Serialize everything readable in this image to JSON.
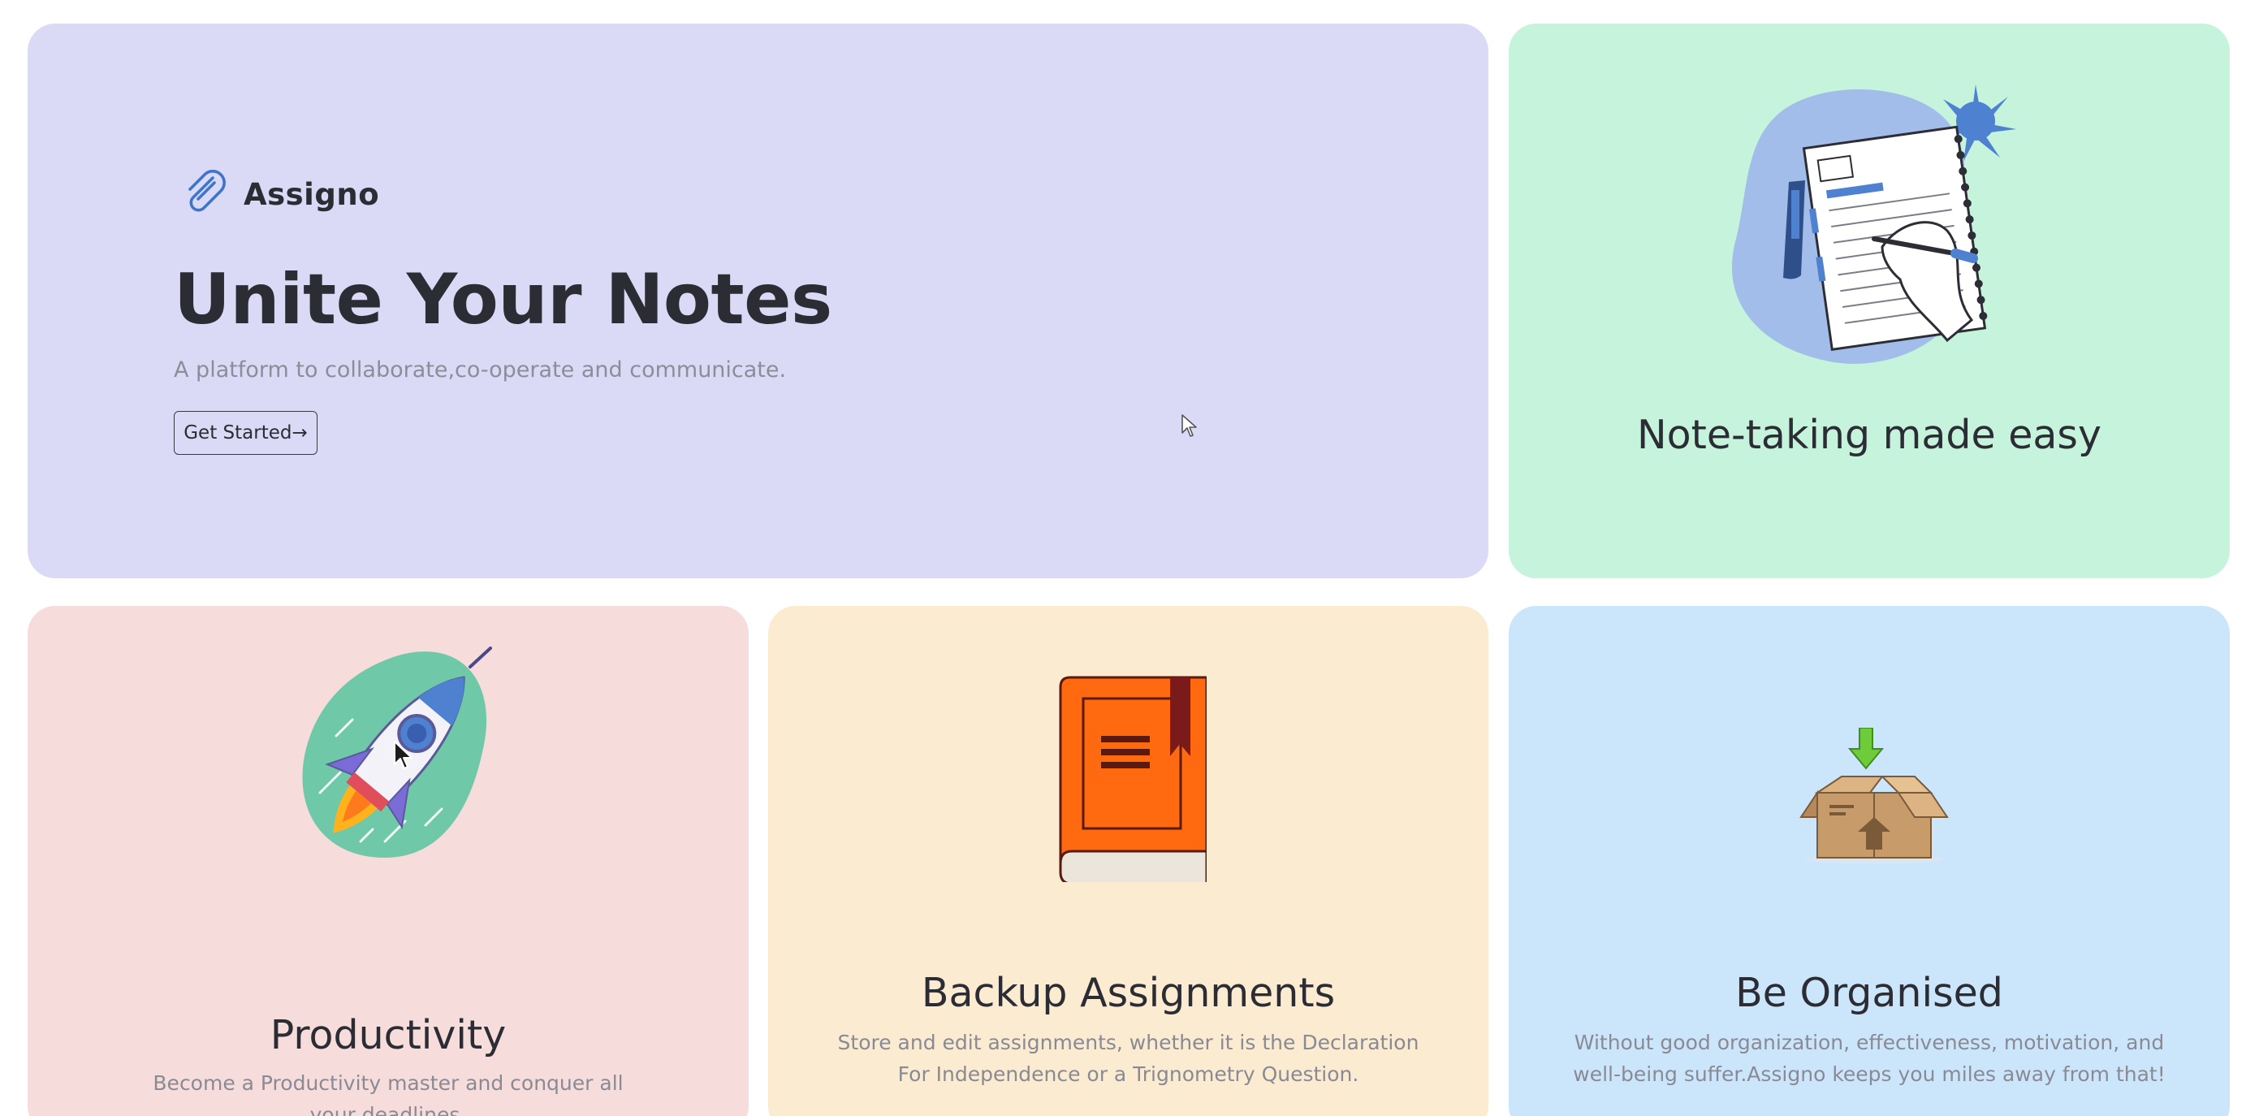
{
  "hero": {
    "brand": "Assigno",
    "title": "Unite Your Notes",
    "subtitle": "A platform to collaborate,co-operate and communicate.",
    "cta_label": "Get Started→"
  },
  "cards": {
    "notes": {
      "title": "Note-taking made easy",
      "icon": "notebook-writing-illustration"
    },
    "productivity": {
      "title": "Productivity",
      "description": "Become a Productivity master and conquer all your deadlines.",
      "icon": "rocket-illustration"
    },
    "backup": {
      "title": "Backup Assignments",
      "description": "Store and edit assignments, whether it is the Declaration For Independence or a Trignometry Question.",
      "icon": "book-illustration"
    },
    "organised": {
      "title": "Be Organised",
      "description": "Without good organization, effectiveness, motivation, and well-being suffer.Assigno keeps you miles away from that!",
      "icon": "box-download-illustration"
    }
  },
  "colors": {
    "hero_bg": "#dbdaf6",
    "notes_bg": "#c5f3dc",
    "productivity_bg": "#f7dcdc",
    "backup_bg": "#faebd1",
    "organised_bg": "#cbe6fb",
    "accent": "#4a7fd4"
  }
}
